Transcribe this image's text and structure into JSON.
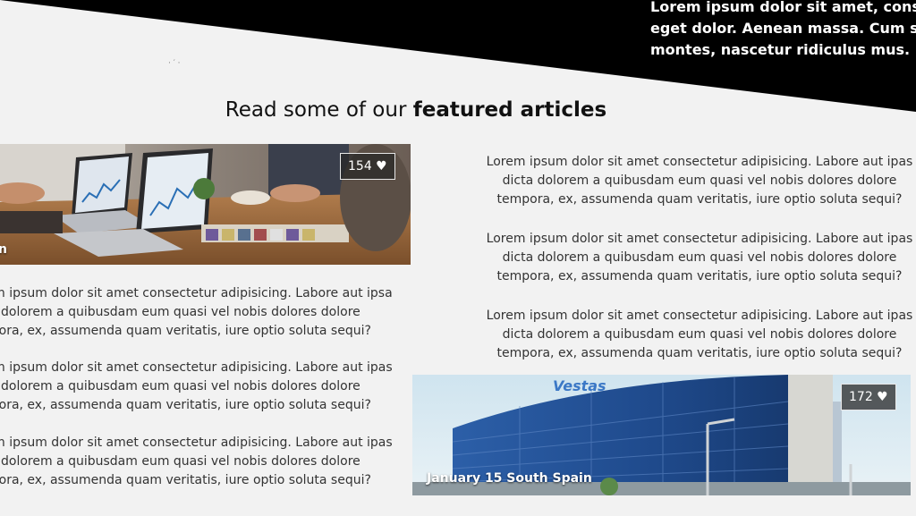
{
  "hero": {
    "text_lines": [
      "Lorem ipsum dolor sit amet, consectetuer adipiscing elit. Aenean commodo ligula",
      "eget dolor. Aenean massa. Cum sociis natoque penatibus et magnis dis parturient",
      "montes, nascetur ridiculus mus. Donec quam felis, ultricies nec."
    ],
    "stray_mark": "· ′ ·"
  },
  "section": {
    "heading_regular": "Read some of our ",
    "heading_bold": "featured articles"
  },
  "card_left": {
    "likes": "154 ♥",
    "caption": "n",
    "paragraphs": [
      [
        "Lorem ipsum dolor sit amet consectetur adipisicing. Labore aut ipsa",
        "dicta dolorem a quibusdam eum quasi vel nobis dolores dolore",
        "tempora, ex, assumenda quam veritatis, iure optio soluta sequi?"
      ],
      [
        "Lorem ipsum dolor sit amet consectetur adipisicing. Labore aut ipas",
        "dicta dolorem a quibusdam eum quasi vel nobis dolores dolore",
        "tempora, ex, assumenda quam veritatis, iure optio soluta sequi?"
      ],
      [
        "Lorem ipsum dolor sit amet consectetur adipisicing. Labore aut ipas",
        "dicta dolorem a quibusdam eum quasi vel nobis dolores dolore",
        "tempora, ex, assumenda quam veritatis, iure optio soluta sequi?"
      ]
    ]
  },
  "card_right": {
    "likes": "172 ♥",
    "caption": "January 15 South Spain",
    "building_sign": "Vestas",
    "paragraphs": [
      "Lorem ipsum dolor sit amet consectetur adipisicing. Labore aut ipas dicta dolorem a quibusdam eum quasi vel nobis dolores dolore tempora, ex, assumenda quam veritatis, iure optio soluta sequi?",
      "Lorem ipsum dolor sit amet consectetur adipisicing. Labore aut ipas dicta dolorem a quibusdam eum quasi vel nobis dolores dolore tempora, ex, assumenda quam veritatis, iure optio soluta sequi?",
      "Lorem ipsum dolor sit amet consectetur adipisicing. Labore aut ipas dicta dolorem a quibusdam eum quasi vel nobis dolores dolore tempora, ex, assumenda quam veritatis, iure optio soluta sequi?"
    ]
  },
  "colors": {
    "page_background": "#f2f2f2",
    "hero_band": "#000000",
    "badge_background": "#3a3a3a"
  }
}
